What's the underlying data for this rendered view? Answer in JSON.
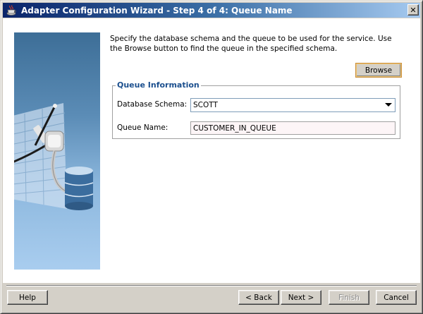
{
  "window": {
    "title": "Adapter Configuration Wizard - Step 4 of 4: Queue Name",
    "app_icon": "java-cup-icon",
    "close_label": "✕"
  },
  "description": "Specify the database schema and the queue to be used for the service. Use the Browse button to find the queue in the specified schema.",
  "browse_button": {
    "label": "Browse",
    "mnemonic": "B"
  },
  "queue_info": {
    "legend": "Queue Information",
    "schema_label": "Database Schema:",
    "schema_value": "SCOTT",
    "queue_label": "Queue Name:",
    "queue_value": "CUSTOMER_IN_QUEUE"
  },
  "footer": {
    "help": "Help",
    "back": "< Back",
    "next": "Next >",
    "finish": "Finish",
    "cancel": "Cancel"
  },
  "colors": {
    "titlebar_start": "#0a246a",
    "titlebar_end": "#a6caf0",
    "legend_text": "#1b4f8e",
    "window_bg": "#d4d0c8"
  }
}
